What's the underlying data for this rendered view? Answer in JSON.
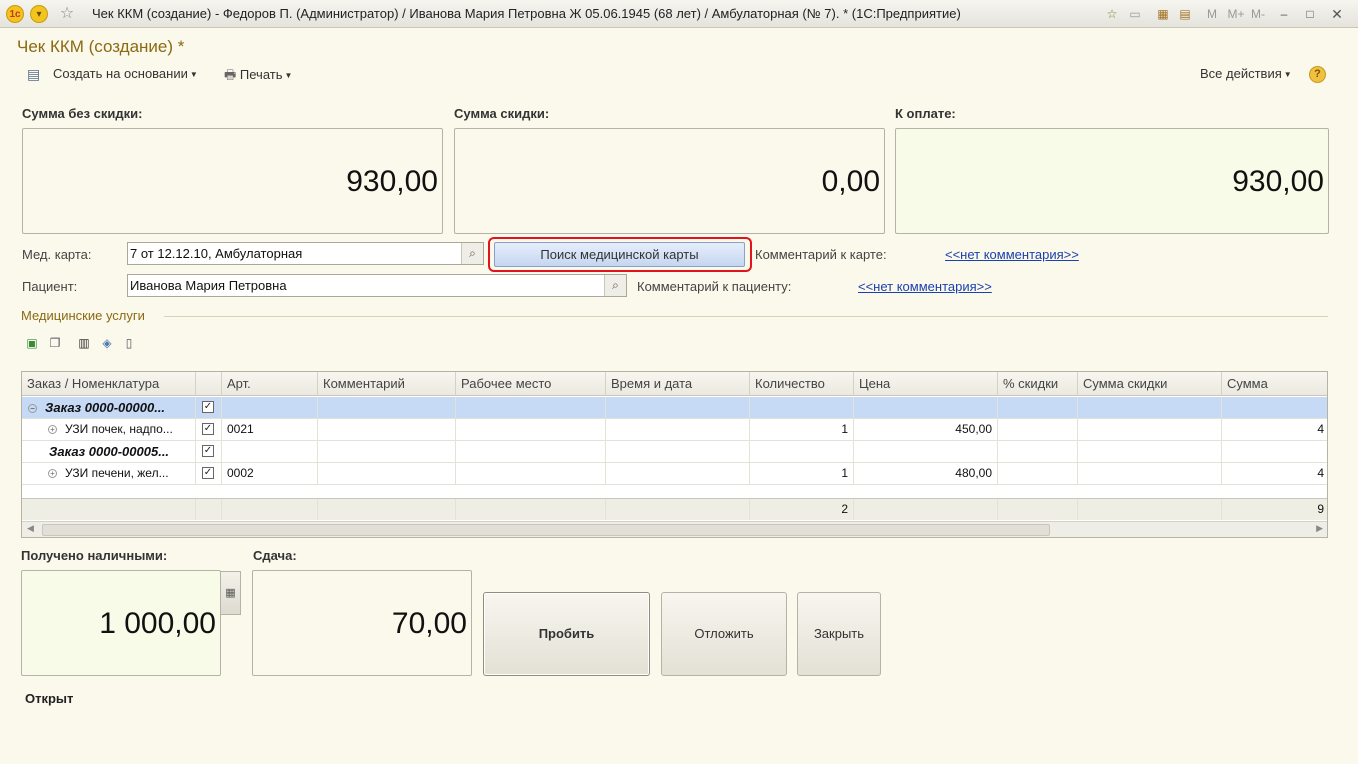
{
  "window": {
    "title": "Чек ККМ (создание) - Федоров П. (Администратор) / Иванова Мария Петровна Ж 05.06.1945 (68 лет) / Амбулаторная (№ 7). * (1С:Предприятие)",
    "right_icons": [
      "M",
      "M+",
      "M-",
      "–",
      "□",
      "✕"
    ]
  },
  "form": {
    "title": "Чек ККМ (создание) *",
    "commands": {
      "create_based": "Создать на основании",
      "print": "Печать",
      "all_actions": "Все действия"
    }
  },
  "totals": {
    "no_discount_label": "Сумма без скидки:",
    "no_discount_value": "930,00",
    "discount_label": "Сумма скидки:",
    "discount_value": "0,00",
    "to_pay_label": "К оплате:",
    "to_pay_value": "930,00"
  },
  "med_card": {
    "label": "Мед. карта:",
    "value": "7 от 12.12.10, Амбулаторная",
    "search_button": "Поиск медицинской карты",
    "comment_label": "Комментарий к карте:",
    "comment_link": "<<нет комментария>>"
  },
  "patient": {
    "label": "Пациент:",
    "value": "Иванова Мария Петровна",
    "comment_label": "Комментарий к пациенту:",
    "comment_link": "<<нет комментария>>"
  },
  "services": {
    "group_title": "Медицинские услуги",
    "columns": [
      "Заказ / Номенклатура",
      "",
      "Арт.",
      "Комментарий",
      "Рабочее место",
      "Время и дата",
      "Количество",
      "Цена",
      "% скидки",
      "Сумма скидки",
      "Сумма"
    ],
    "rows": [
      {
        "name": "Заказ 0000-00000...",
        "expander": "⊖",
        "checked": true,
        "art": "",
        "qty": "",
        "price": "",
        "sum": "",
        "group": true,
        "selected": true
      },
      {
        "name": "УЗИ почек, надпо...",
        "expander": "⊕",
        "checked": true,
        "art": "0021",
        "qty": "1",
        "price": "450,00",
        "sum": "4",
        "group": false,
        "selected": false
      },
      {
        "name": "Заказ 0000-00005...",
        "expander": "",
        "checked": true,
        "art": "",
        "qty": "",
        "price": "",
        "sum": "",
        "group": true,
        "selected": false
      },
      {
        "name": "УЗИ печени, жел...",
        "expander": "⊕",
        "checked": true,
        "art": "0002",
        "qty": "1",
        "price": "480,00",
        "sum": "4",
        "group": false,
        "selected": false
      }
    ],
    "footer": {
      "qty_total": "2",
      "sum_total": "9"
    }
  },
  "payment": {
    "cash_label": "Получено наличными:",
    "cash_value": "1 000,00",
    "change_label": "Сдача:",
    "change_value": "70,00"
  },
  "buttons": {
    "punch": "Пробить",
    "defer": "Отложить",
    "close": "Закрыть"
  },
  "status": "Открыт",
  "colors": {
    "accent_title": "#8b6a12",
    "highlight": "#e0141a",
    "link": "#1c40b0",
    "selected_row": "#c6daf6"
  }
}
